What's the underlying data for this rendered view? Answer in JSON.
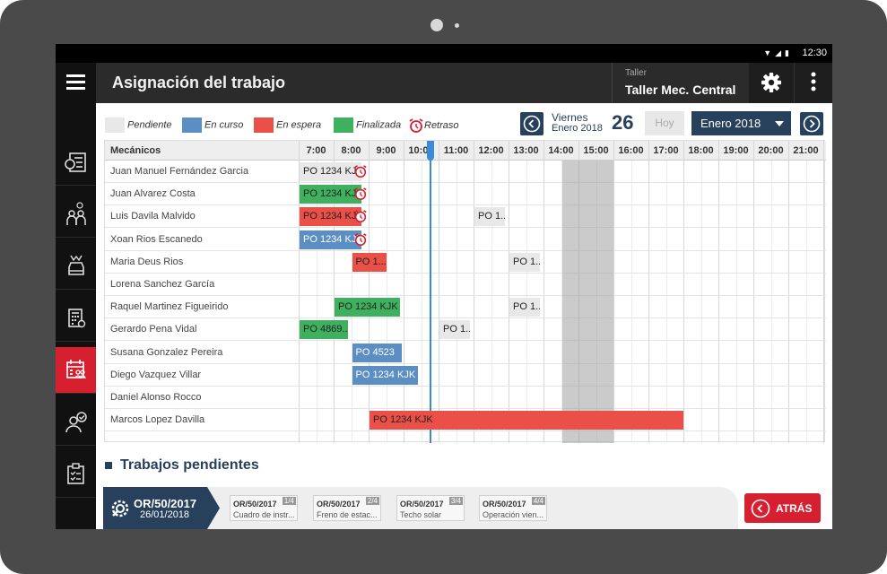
{
  "statusbar": {
    "time": "12:30",
    "icons": [
      "wifi-icon",
      "signal-icon",
      "battery-icon"
    ]
  },
  "app": {
    "title": "Asignación del trabajo",
    "taller_label": "Taller",
    "taller_value": "Taller Mec. Central"
  },
  "legend": [
    {
      "label": "Pendiente",
      "color": "#e8e8e8"
    },
    {
      "label": "En curso",
      "color": "#5b8ec3"
    },
    {
      "label": "En espera",
      "color": "#ea5048"
    },
    {
      "label": "Finalizada",
      "color": "#3fb15e"
    },
    {
      "label": "Retraso",
      "icon": "alarm-clock-icon",
      "color": "#d7202f"
    }
  ],
  "date_nav": {
    "day_name": "Viernes",
    "month_year": "Enero 2018",
    "day_number": "26",
    "today_button": "Hoy",
    "month_select": "Enero 2018"
  },
  "grid": {
    "mechanic_header": "Mecánicos",
    "hours": [
      "7:00",
      "8:00",
      "9:00",
      "10:00",
      "11:00",
      "12:00",
      "13:00",
      "14:00",
      "15:00",
      "16:00",
      "17:00",
      "18:00",
      "19:00",
      "20:00",
      "21:00"
    ],
    "mechanics": [
      "Juan Manuel Fernández Garcia",
      "Juan Alvarez Costa",
      "Luis Davila Malvido",
      "Xoan Rios Escanedo",
      "Maria Deus Rios",
      "Lorena Sanchez García",
      "Raquel Martinez Figueirido",
      "Gerardo Pena Vidal",
      "Susana Gonzalez Pereira",
      "Diego Vazquez Villar",
      "Daniel Alonso Rocco",
      "Marcos Lopez Davilla"
    ],
    "tasks": [
      {
        "row": 0,
        "start": 7.0,
        "end": 8.8,
        "label": "PO 1234 KJK",
        "status": "pend",
        "delayed": true
      },
      {
        "row": 1,
        "start": 7.0,
        "end": 8.8,
        "label": "PO 1234 KJK",
        "status": "green",
        "delayed": true
      },
      {
        "row": 2,
        "start": 7.0,
        "end": 8.8,
        "label": "PO 1234 KJK",
        "status": "red",
        "delayed": true
      },
      {
        "row": 2,
        "start": 12.0,
        "end": 12.9,
        "label": "PO 1...",
        "status": "pend",
        "delayed": false
      },
      {
        "row": 3,
        "start": 7.0,
        "end": 8.8,
        "label": "PO 1234 KJK",
        "status": "blue",
        "delayed": true
      },
      {
        "row": 4,
        "start": 8.5,
        "end": 9.5,
        "label": "PO 1...",
        "status": "red",
        "delayed": false
      },
      {
        "row": 4,
        "start": 13.0,
        "end": 13.9,
        "label": "PO 1...",
        "status": "pend",
        "delayed": false
      },
      {
        "row": 6,
        "start": 8.0,
        "end": 9.9,
        "label": "PO 1234 KJK",
        "status": "green",
        "delayed": false
      },
      {
        "row": 6,
        "start": 13.0,
        "end": 13.9,
        "label": "PO 1...",
        "status": "pend",
        "delayed": false
      },
      {
        "row": 7,
        "start": 7.0,
        "end": 8.4,
        "label": "PO 4869...",
        "status": "green",
        "delayed": false
      },
      {
        "row": 7,
        "start": 11.0,
        "end": 11.9,
        "label": "PO 1...",
        "status": "pend",
        "delayed": false
      },
      {
        "row": 8,
        "start": 8.5,
        "end": 9.95,
        "label": "PO 4523",
        "status": "blue",
        "delayed": false
      },
      {
        "row": 9,
        "start": 8.5,
        "end": 10.4,
        "label": "PO 1234 KJK",
        "status": "blue",
        "delayed": false
      },
      {
        "row": 11,
        "start": 9.0,
        "end": 18.0,
        "label": "PO 1234 KJK",
        "status": "red",
        "delayed": false
      }
    ]
  },
  "pending": {
    "title": "Trabajos pendientes",
    "order_code": "OR/50/2017",
    "order_date": "26/01/2018",
    "cards": [
      {
        "code": "OR/50/2017",
        "num": "1/4",
        "desc": "Cuadro de instr..."
      },
      {
        "code": "OR/50/2017",
        "num": "2/4",
        "desc": "Freno de estac..."
      },
      {
        "code": "OR/50/2017",
        "num": "3/4",
        "desc": "Techo solar"
      },
      {
        "code": "OR/50/2017",
        "num": "4/4",
        "desc": "Operación vien..."
      }
    ],
    "back_button": "ATRÁS"
  }
}
